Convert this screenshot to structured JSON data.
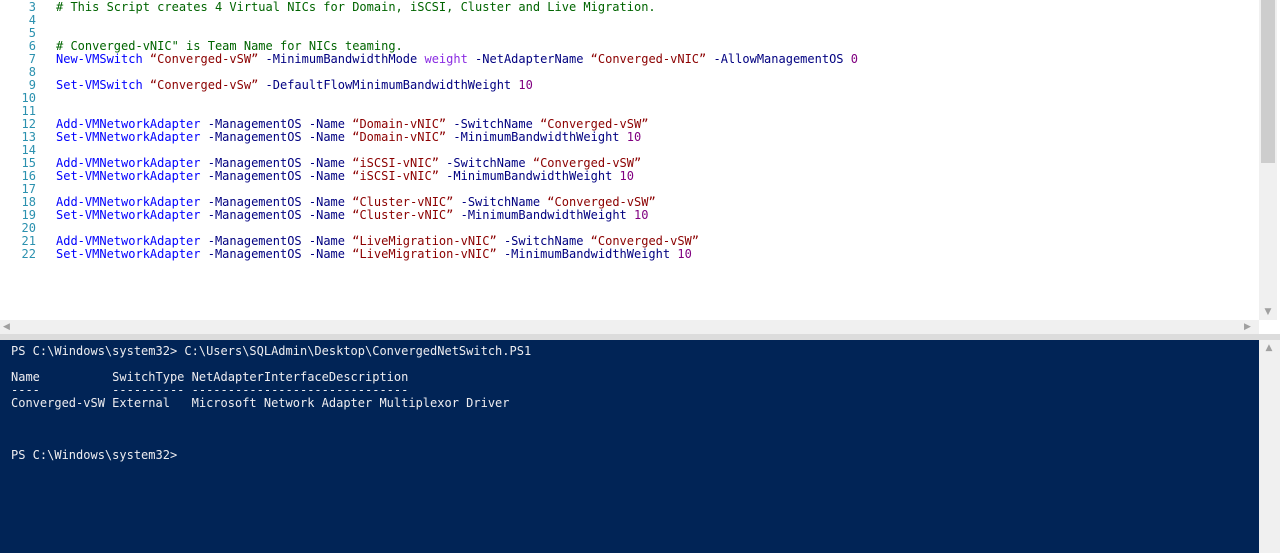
{
  "editor": {
    "lines": [
      {
        "n": "3",
        "parts": [
          {
            "t": "# This Script creates 4 Virtual NICs for Domain, iSCSI, Cluster and Live Migration.",
            "c": "comment"
          }
        ]
      },
      {
        "n": "4",
        "parts": []
      },
      {
        "n": "5",
        "parts": []
      },
      {
        "n": "6",
        "parts": [
          {
            "t": "# Converged-vNIC\" is Team Name for NICs teaming.",
            "c": "comment"
          }
        ]
      },
      {
        "n": "7",
        "parts": [
          {
            "t": "New-VMSwitch ",
            "c": "cmd"
          },
          {
            "t": "“Converged-vSW”",
            "c": "str"
          },
          {
            "t": " -MinimumBandwidthMode ",
            "c": "param"
          },
          {
            "t": "weight",
            "c": "kw"
          },
          {
            "t": " -NetAdapterName ",
            "c": "param"
          },
          {
            "t": "“Converged-vNIC”",
            "c": "str"
          },
          {
            "t": " -AllowManagementOS ",
            "c": "param"
          },
          {
            "t": "0",
            "c": "num"
          }
        ]
      },
      {
        "n": "8",
        "parts": []
      },
      {
        "n": "9",
        "parts": [
          {
            "t": "Set-VMSwitch ",
            "c": "cmd"
          },
          {
            "t": "“Converged-vSw”",
            "c": "str"
          },
          {
            "t": " -DefaultFlowMinimumBandwidthWeight ",
            "c": "param"
          },
          {
            "t": "10",
            "c": "num"
          }
        ]
      },
      {
        "n": "10",
        "parts": []
      },
      {
        "n": "11",
        "parts": []
      },
      {
        "n": "12",
        "parts": [
          {
            "t": "Add-VMNetworkAdapter ",
            "c": "cmd"
          },
          {
            "t": "-ManagementOS -Name ",
            "c": "param"
          },
          {
            "t": "“Domain-vNIC”",
            "c": "str"
          },
          {
            "t": " -SwitchName ",
            "c": "param"
          },
          {
            "t": "“Converged-vSW”",
            "c": "str"
          }
        ]
      },
      {
        "n": "13",
        "parts": [
          {
            "t": "Set-VMNetworkAdapter ",
            "c": "cmd"
          },
          {
            "t": "-ManagementOS -Name ",
            "c": "param"
          },
          {
            "t": "“Domain-vNIC”",
            "c": "str"
          },
          {
            "t": " -MinimumBandwidthWeight ",
            "c": "param"
          },
          {
            "t": "10",
            "c": "num"
          }
        ]
      },
      {
        "n": "14",
        "parts": []
      },
      {
        "n": "15",
        "parts": [
          {
            "t": "Add-VMNetworkAdapter ",
            "c": "cmd"
          },
          {
            "t": "-ManagementOS -Name ",
            "c": "param"
          },
          {
            "t": "“iSCSI-vNIC”",
            "c": "str"
          },
          {
            "t": " -SwitchName ",
            "c": "param"
          },
          {
            "t": "“Converged-vSW”",
            "c": "str"
          }
        ]
      },
      {
        "n": "16",
        "parts": [
          {
            "t": "Set-VMNetworkAdapter ",
            "c": "cmd"
          },
          {
            "t": "-ManagementOS -Name ",
            "c": "param"
          },
          {
            "t": "“iSCSI-vNIC”",
            "c": "str"
          },
          {
            "t": " -MinimumBandwidthWeight ",
            "c": "param"
          },
          {
            "t": "10",
            "c": "num"
          }
        ]
      },
      {
        "n": "17",
        "parts": []
      },
      {
        "n": "18",
        "parts": [
          {
            "t": "Add-VMNetworkAdapter ",
            "c": "cmd"
          },
          {
            "t": "-ManagementOS -Name ",
            "c": "param"
          },
          {
            "t": "“Cluster-vNIC”",
            "c": "str"
          },
          {
            "t": " -SwitchName ",
            "c": "param"
          },
          {
            "t": "“Converged-vSW”",
            "c": "str"
          }
        ]
      },
      {
        "n": "19",
        "parts": [
          {
            "t": "Set-VMNetworkAdapter ",
            "c": "cmd"
          },
          {
            "t": "-ManagementOS -Name ",
            "c": "param"
          },
          {
            "t": "“Cluster-vNIC”",
            "c": "str"
          },
          {
            "t": " -MinimumBandwidthWeight ",
            "c": "param"
          },
          {
            "t": "10",
            "c": "num"
          }
        ]
      },
      {
        "n": "20",
        "parts": []
      },
      {
        "n": "21",
        "parts": [
          {
            "t": "Add-VMNetworkAdapter ",
            "c": "cmd"
          },
          {
            "t": "-ManagementOS -Name ",
            "c": "param"
          },
          {
            "t": "“LiveMigration-vNIC”",
            "c": "str"
          },
          {
            "t": " -SwitchName ",
            "c": "param"
          },
          {
            "t": "“Converged-vSW”",
            "c": "str"
          }
        ]
      },
      {
        "n": "22",
        "parts": [
          {
            "t": "Set-VMNetworkAdapter ",
            "c": "cmd"
          },
          {
            "t": "-ManagementOS -Name ",
            "c": "param"
          },
          {
            "t": "“LiveMigration-vNIC”",
            "c": "str"
          },
          {
            "t": " -MinimumBandwidthWeight ",
            "c": "param"
          },
          {
            "t": "10",
            "c": "num"
          }
        ]
      }
    ],
    "scroll_icons": {
      "down": "scroll-down-arrow-icon",
      "left": "scroll-left-arrow-icon",
      "right": "scroll-right-arrow-icon"
    }
  },
  "console": {
    "lines": [
      "PS C:\\Windows\\system32> C:\\Users\\SQLAdmin\\Desktop\\ConvergedNetSwitch.PS1",
      "",
      "Name          SwitchType NetAdapterInterfaceDescription",
      "----          ---------- ------------------------------",
      "Converged-vSW External   Microsoft Network Adapter Multiplexor Driver",
      "",
      "",
      "",
      "PS C:\\Windows\\system32>"
    ],
    "background": "#012456",
    "foreground": "#eeedf0"
  }
}
